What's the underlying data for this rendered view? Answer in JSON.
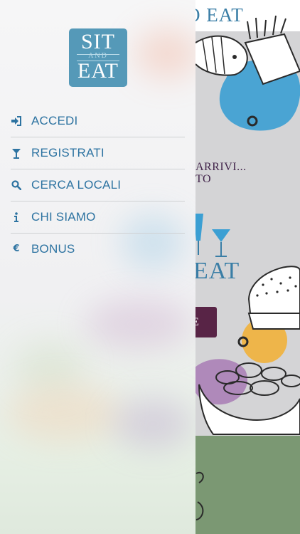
{
  "background": {
    "header_title": "O EAT",
    "headline": "ARRIVI...\nTO",
    "eat_logo": "EAT",
    "cta_label": "E"
  },
  "drawer": {
    "logo": {
      "top": "SIT",
      "middle": "AND",
      "bottom": "EAT"
    },
    "menu": [
      {
        "label": "ACCEDI",
        "icon": "sign-in-icon"
      },
      {
        "label": "REGISTRATI",
        "icon": "cocktail-glass-icon"
      },
      {
        "label": "CERCA LOCALI",
        "icon": "search-icon"
      },
      {
        "label": "CHI SIAMO",
        "icon": "info-icon"
      },
      {
        "label": "BONUS",
        "icon": "euro-icon"
      }
    ]
  },
  "colors": {
    "accent": "#2d73a1",
    "logo_bg": "#5599b8",
    "cta_bg": "#582446",
    "footer_bg": "#7b9873"
  }
}
